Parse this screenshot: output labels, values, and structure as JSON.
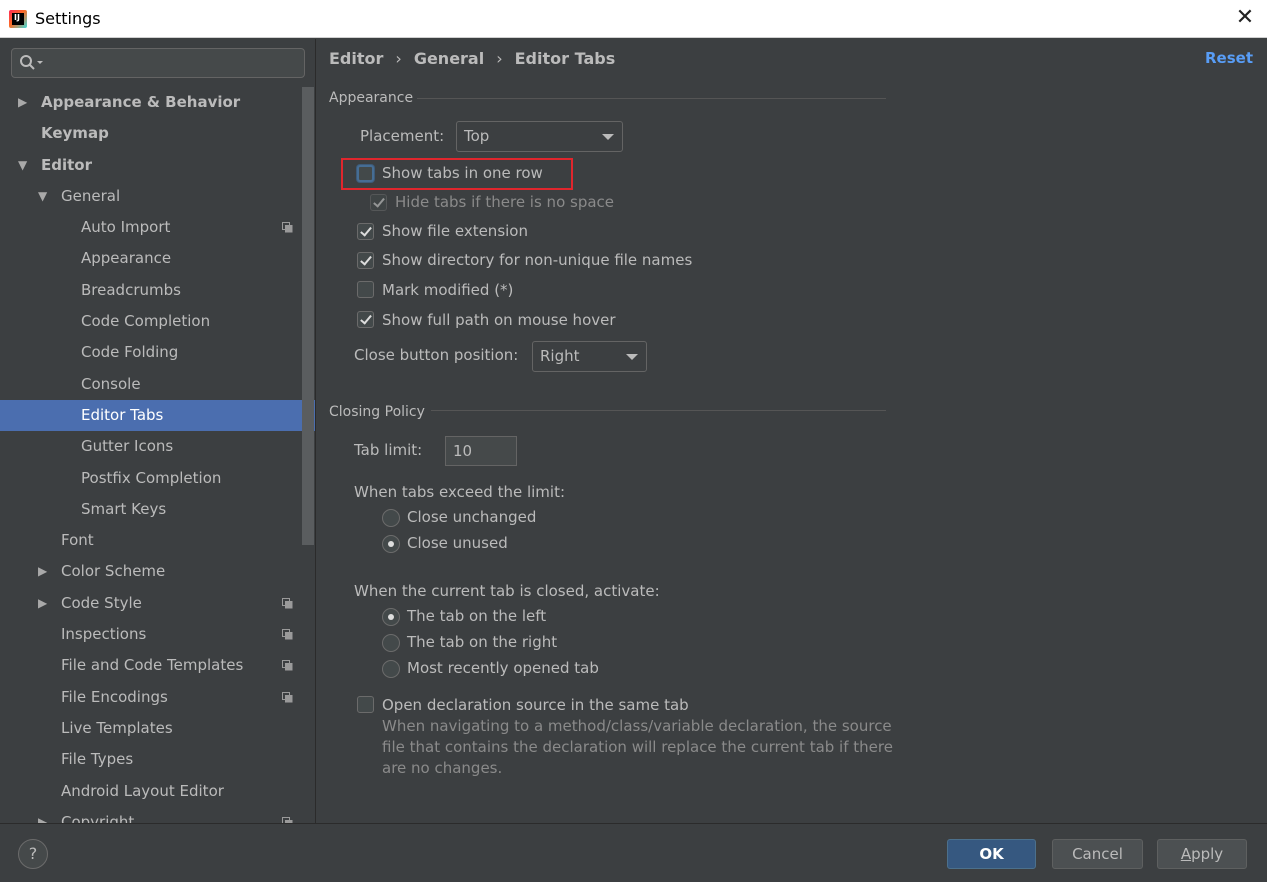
{
  "window": {
    "title": "Settings",
    "close_label": "✕"
  },
  "sidebar": {
    "search_placeholder": "",
    "items": [
      {
        "label": "Appearance & Behavior",
        "arrow": "▶",
        "bold": true
      },
      {
        "label": "Keymap",
        "arrow": "",
        "bold": true
      },
      {
        "label": "Editor",
        "arrow": "▼",
        "bold": true
      },
      {
        "label": "General",
        "arrow": "▼"
      },
      {
        "label": "Auto Import"
      },
      {
        "label": "Appearance"
      },
      {
        "label": "Breadcrumbs"
      },
      {
        "label": "Code Completion"
      },
      {
        "label": "Code Folding"
      },
      {
        "label": "Console"
      },
      {
        "label": "Editor Tabs"
      },
      {
        "label": "Gutter Icons"
      },
      {
        "label": "Postfix Completion"
      },
      {
        "label": "Smart Keys"
      },
      {
        "label": "Font"
      },
      {
        "label": "Color Scheme",
        "arrow": "▶"
      },
      {
        "label": "Code Style",
        "arrow": "▶"
      },
      {
        "label": "Inspections"
      },
      {
        "label": "File and Code Templates"
      },
      {
        "label": "File Encodings"
      },
      {
        "label": "Live Templates"
      },
      {
        "label": "File Types"
      },
      {
        "label": "Android Layout Editor"
      },
      {
        "label": "Copyright",
        "arrow": "▶"
      }
    ]
  },
  "breadcrumb": {
    "items": [
      "Editor",
      "General",
      "Editor Tabs"
    ],
    "separator": "›"
  },
  "reset_label": "Reset",
  "appearance": {
    "title": "Appearance",
    "placement_label": "Placement:",
    "placement_value": "Top",
    "show_one_row": "Show tabs in one row",
    "hide_no_space": "Hide tabs if there is no space",
    "show_extension": "Show file extension",
    "show_directory": "Show directory for non-unique file names",
    "mark_modified": "Mark modified (*)",
    "show_full_path": "Show full path on mouse hover",
    "close_pos_label": "Close button position:",
    "close_pos_value": "Right"
  },
  "closing": {
    "title": "Closing Policy",
    "tab_limit_label": "Tab limit:",
    "tab_limit_value": "10",
    "exceed_label": "When tabs exceed the limit:",
    "close_unchanged": "Close unchanged",
    "close_unused": "Close unused",
    "activate_label": "When the current tab is closed, activate:",
    "tab_left": "The tab on the left",
    "tab_right": "The tab on the right",
    "most_recent": "Most recently opened tab",
    "open_decl": "Open declaration source in the same tab",
    "desc_line1": "When navigating to a method/class/variable declaration, the source",
    "desc_line2": "file that contains the declaration will replace the current tab if there",
    "desc_line3": "are no changes."
  },
  "footer": {
    "help": "?",
    "ok": "OK",
    "cancel": "Cancel",
    "apply_mnemonic": "A",
    "apply_rest": "pply"
  },
  "colors": {
    "selection": "#4b6eaf",
    "link": "#589df6",
    "highlight": "#e0262d",
    "primary_button": "#365880"
  }
}
